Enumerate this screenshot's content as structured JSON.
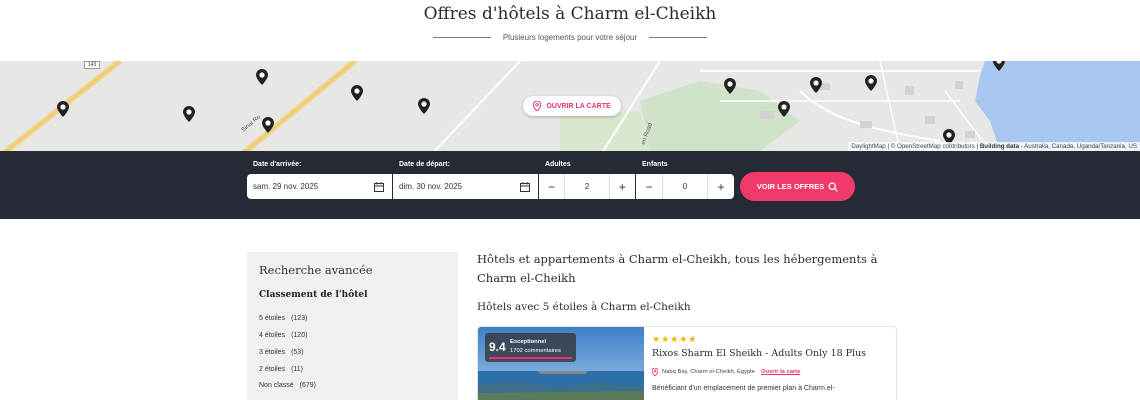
{
  "header": {
    "title": "Offres d'hôtels à Charm el-Cheikh",
    "subtitle": "Plusieurs logements pour votre séjour"
  },
  "map": {
    "open_map_label": "OUVRIR LA CARTE",
    "attribution": "DaylightMap | © OpenStreetMap contributors | ",
    "attribution_bold": "Building data",
    "attribution_tail": " - Australia, Canada, Uganda/Tanzania, US",
    "road_badge": "143",
    "road_label_1": "Sinai Ro",
    "road_label_2": "en Road"
  },
  "search": {
    "arrival_label": "Date d'arrivée:",
    "arrival_value": "sam. 29 nov. 2025",
    "departure_label": "Date de départ:",
    "departure_value": "dim. 30 nov. 2025",
    "adults_label": "Adultes",
    "adults_value": "2",
    "children_label": "Enfants",
    "children_value": "0",
    "minus": "−",
    "plus": "+",
    "cta_label": "VOIR LES OFFRES"
  },
  "sidebar": {
    "title": "Recherche avancée",
    "section": "Classement de l'hôtel",
    "options": [
      {
        "label": "5 étoiles",
        "count": "(123)"
      },
      {
        "label": "4 étoiles",
        "count": "(120)"
      },
      {
        "label": "3 étoiles",
        "count": "(53)"
      },
      {
        "label": "2 étoiles",
        "count": "(11)"
      },
      {
        "label": "Non classé",
        "count": "(679)"
      }
    ]
  },
  "main": {
    "heading": "Hôtels et appartements à Charm el-Cheikh, tous les hébergements à Charm el-Cheikh",
    "subheading": "Hôtels avec 5 étoiles à Charm el-Cheikh"
  },
  "hotel": {
    "score": "9.4",
    "score_label": "Exceptionnel",
    "reviews": "1702 commentaires",
    "stars": "★★★★★",
    "name": "Rixos Sharm El Sheikh - Adults Only 18 Plus",
    "location": "Nabq Bay, Charm el-Cheikh, Égypte",
    "map_link": "Ouvrir la carte",
    "description": "Bénéficiant d'un emplacement de premier plan à Charm el-"
  },
  "colors": {
    "accent": "#ef3a6a",
    "dark_bar": "#262a36",
    "star": "#f6b400"
  }
}
